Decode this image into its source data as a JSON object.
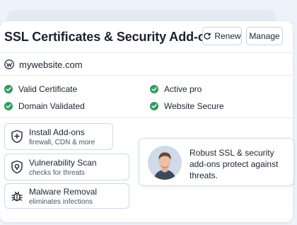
{
  "header": {
    "title": "SSL Certificates & Security Add-on",
    "renew_label": "Renew",
    "manage_label": "Manage"
  },
  "site": {
    "domain": "mywebsite.com",
    "icon": "wordpress-icon"
  },
  "status_items": [
    {
      "label": "Valid Certificate",
      "icon": "check-circle-icon"
    },
    {
      "label": "Active pro",
      "icon": "check-circle-icon"
    },
    {
      "label": "Domain Validated",
      "icon": "check-circle-icon"
    },
    {
      "label": "Website Secure",
      "icon": "check-circle-icon"
    }
  ],
  "features": [
    {
      "title": "Install Add-ons",
      "subtitle": "firewall, CDN & more",
      "icon": "shield-plus-icon"
    },
    {
      "title": "Vulnerability Scan",
      "subtitle": "checks for threats",
      "icon": "shield-lock-icon"
    },
    {
      "title": "Malware Removal",
      "subtitle": "eliminates infections",
      "icon": "bug-icon"
    }
  ],
  "testimonial": {
    "text": "Robust SSL & security add-ons protect against threats."
  },
  "colors": {
    "accent_green": "#2f9e5f",
    "background": "#eef3fa",
    "border": "#cfd9e6"
  }
}
